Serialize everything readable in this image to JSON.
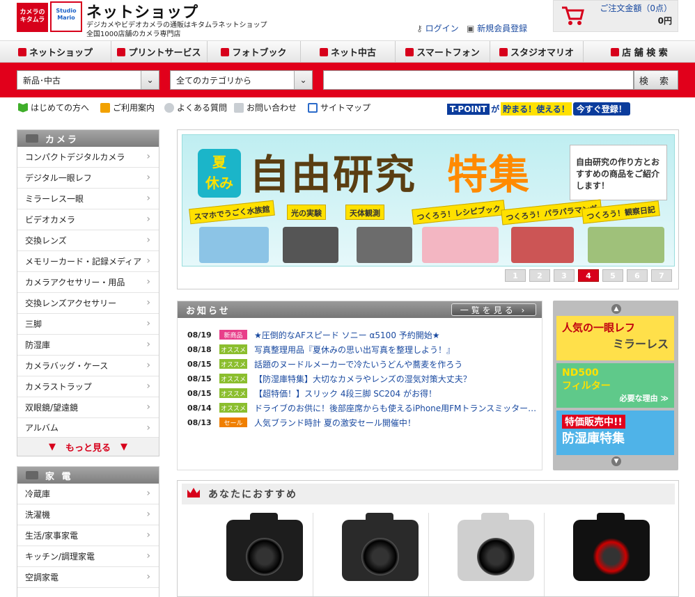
{
  "header": {
    "logo1_text": "カメラの\nキタムラ",
    "logo2_text": "Studio\nMario",
    "title": "ネットショップ",
    "tagline1": "デジカメやビデオカメラの通販はキタムラネットショップ",
    "tagline2": "全国1000店舗のカメラ専門店",
    "login": "ログイン",
    "register": "新規会員登録",
    "cart_label": "ご注文金額（0点）",
    "cart_amount": "0円"
  },
  "nav": [
    {
      "label": "ネットショップ",
      "icon": "camera-icon"
    },
    {
      "label": "プリントサービス",
      "icon": "print-icon"
    },
    {
      "label": "フォトブック",
      "icon": "book-icon"
    },
    {
      "label": "ネット中古",
      "icon": "used-icon"
    },
    {
      "label": "スマートフォン",
      "icon": "phone-icon"
    },
    {
      "label": "スタジオマリオ",
      "icon": "studio-icon"
    },
    {
      "label": "店 舗 検 索",
      "icon": "store-icon"
    }
  ],
  "search": {
    "condition": "新品･中古",
    "category": "全てのカテゴリから",
    "query": "",
    "button": "検 索"
  },
  "util_links": [
    {
      "label": "はじめての方へ",
      "icon": "beginner-icon",
      "color": "#3fae2a"
    },
    {
      "label": "ご利用案内",
      "icon": "guide-icon",
      "color": "#f2a100"
    },
    {
      "label": "よくある質問",
      "icon": "faq-icon",
      "color": "#9aa0a6"
    },
    {
      "label": "お問い合わせ",
      "icon": "contact-icon",
      "color": "#9aa0a6"
    },
    {
      "label": "サイトマップ",
      "icon": "sitemap-icon",
      "color": "#2a6ac9"
    }
  ],
  "tpoint": {
    "logo": "T-POINT",
    "ga": "が",
    "text": "貯まる！使える！",
    "button": "今すぐ登録！"
  },
  "sidebar_camera": {
    "title": "カメラ",
    "items": [
      "コンパクトデジタルカメラ",
      "デジタル一眼レフ",
      "ミラーレス一眼",
      "ビデオカメラ",
      "交換レンズ",
      "メモリーカード・記録メディア",
      "カメラアクセサリー・用品",
      "交換レンズアクセサリー",
      "三脚",
      "防湿庫",
      "カメラバッグ・ケース",
      "カメラストラップ",
      "双眼鏡/望遠鏡",
      "アルバム"
    ],
    "more": "もっと見る"
  },
  "sidebar_kaden": {
    "title": "家 電",
    "items": [
      "冷蔵庫",
      "洗濯機",
      "生活/家事家電",
      "キッチン/調理家電",
      "空調家電"
    ]
  },
  "banner": {
    "natsu": "夏\n休み",
    "title_brown": "自由研究",
    "title_orange": "特集",
    "note": "自由研究の作り方とおすすめの商品をご紹介します！",
    "tags": [
      "スマホでうごく水族館",
      "光の実験",
      "天体観測",
      "つくろう！レシピブック",
      "つくろう！パラパラマンガ",
      "つくろう！観察日記"
    ],
    "pages": [
      "1",
      "2",
      "3",
      "4",
      "5",
      "6",
      "7"
    ],
    "current_page": "4"
  },
  "news": {
    "title": "お知らせ",
    "more": "一覧を見る ›",
    "items": [
      {
        "date": "08/19",
        "badge": "新商品",
        "badge_color": "#e83f8a",
        "text": "★圧倒的なAFスピード ソニー α5100 予約開始★"
      },
      {
        "date": "08/18",
        "badge": "オススメ",
        "badge_color": "#8bbe2e",
        "text": "写真整理用品『夏休みの思い出写真を整理しよう！』"
      },
      {
        "date": "08/15",
        "badge": "オススメ",
        "badge_color": "#8bbe2e",
        "text": "話題のヌードルメーカーで冷たいうどんや蕎麦を作ろう"
      },
      {
        "date": "08/15",
        "badge": "オススメ",
        "badge_color": "#8bbe2e",
        "text": "【防湿庫特集】大切なカメラやレンズの湿気対策大丈夫？"
      },
      {
        "date": "08/15",
        "badge": "オススメ",
        "badge_color": "#8bbe2e",
        "text": "【超特価！】スリック 4段三脚 SC204 がお得！"
      },
      {
        "date": "08/14",
        "badge": "オススメ",
        "badge_color": "#8bbe2e",
        "text": "ドライブのお供に！後部座席からも使えるiPhone用FMトランスミッター…"
      },
      {
        "date": "08/13",
        "badge": "セール",
        "badge_color": "#f07f00",
        "text": "人気ブランド時計 夏の激安セール開催中！"
      }
    ]
  },
  "side_banners": [
    {
      "line1": "人気の一眼レフ",
      "line2": "ミラーレス"
    },
    {
      "line1": "ND500",
      "line2": "フィルター",
      "line3": "必要な理由 ≫"
    },
    {
      "line1": "特価販売中!!",
      "line2": "防湿庫特集"
    }
  ],
  "recommend": {
    "title": "あなたにおすすめ"
  },
  "colors": {
    "brand_red": "#e1001b",
    "link_blue": "#1a4aa0"
  }
}
